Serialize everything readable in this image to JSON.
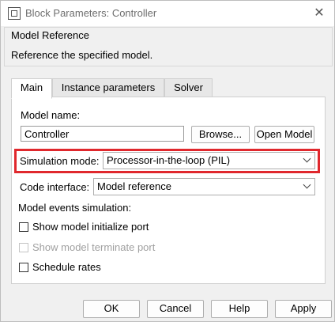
{
  "window": {
    "title": "Block Parameters: Controller"
  },
  "header": {
    "title": "Model Reference",
    "description": "Reference the specified model."
  },
  "tabs": [
    {
      "label": "Main",
      "active": true
    },
    {
      "label": "Instance parameters",
      "active": false
    },
    {
      "label": "Solver",
      "active": false
    }
  ],
  "main": {
    "model_name_label": "Model name:",
    "model_name_value": "Controller",
    "browse_label": "Browse...",
    "open_model_label": "Open Model",
    "sim_mode_label": "Simulation mode:",
    "sim_mode_value": "Processor-in-the-loop (PIL)",
    "code_interface_label": "Code interface:",
    "code_interface_value": "Model reference",
    "model_events_label": "Model events simulation:",
    "show_init_port_label": "Show model initialize port",
    "show_term_port_label": "Show model terminate port",
    "schedule_rates_label": "Schedule rates"
  },
  "footer": {
    "ok": "OK",
    "cancel": "Cancel",
    "help": "Help",
    "apply": "Apply"
  },
  "colors": {
    "highlight": "#e0282d"
  }
}
